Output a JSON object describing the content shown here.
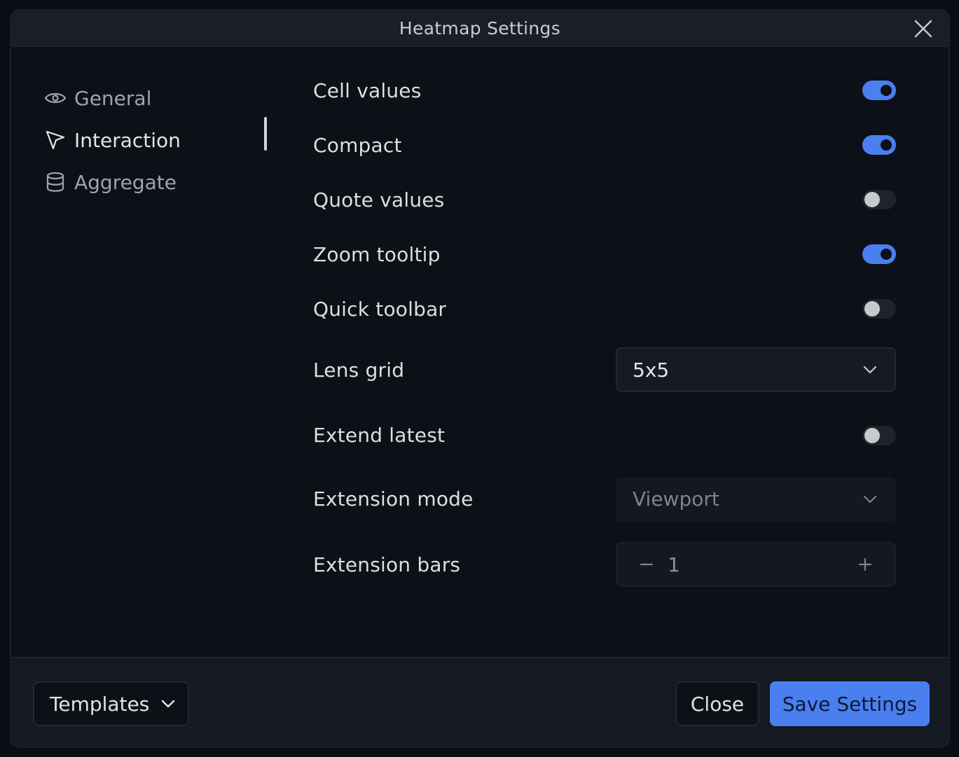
{
  "window": {
    "title": "Heatmap Settings"
  },
  "sidebar": {
    "items": [
      {
        "label": "General",
        "icon": "eye-icon",
        "active": false
      },
      {
        "label": "Interaction",
        "icon": "cursor-arrow-icon",
        "active": true
      },
      {
        "label": "Aggregate",
        "icon": "database-icon",
        "active": false
      }
    ]
  },
  "settings": {
    "cell_values": {
      "label": "Cell values",
      "enabled": true
    },
    "compact": {
      "label": "Compact",
      "enabled": true
    },
    "quote_values": {
      "label": "Quote values",
      "enabled": false
    },
    "zoom_tooltip": {
      "label": "Zoom tooltip",
      "enabled": true
    },
    "quick_toolbar": {
      "label": "Quick toolbar",
      "enabled": false
    },
    "lens_grid": {
      "label": "Lens grid",
      "value": "5x5"
    },
    "extend_latest": {
      "label": "Extend latest",
      "enabled": false
    },
    "extension_mode": {
      "label": "Extension mode",
      "value": "Viewport",
      "disabled": true
    },
    "extension_bars": {
      "label": "Extension bars",
      "value": "1"
    }
  },
  "footer": {
    "templates_label": "Templates",
    "close_label": "Close",
    "save_label": "Save Settings"
  },
  "colors": {
    "accent": "#4a7ff0",
    "background": "#0d1017",
    "titlebar": "#1a1e27"
  }
}
